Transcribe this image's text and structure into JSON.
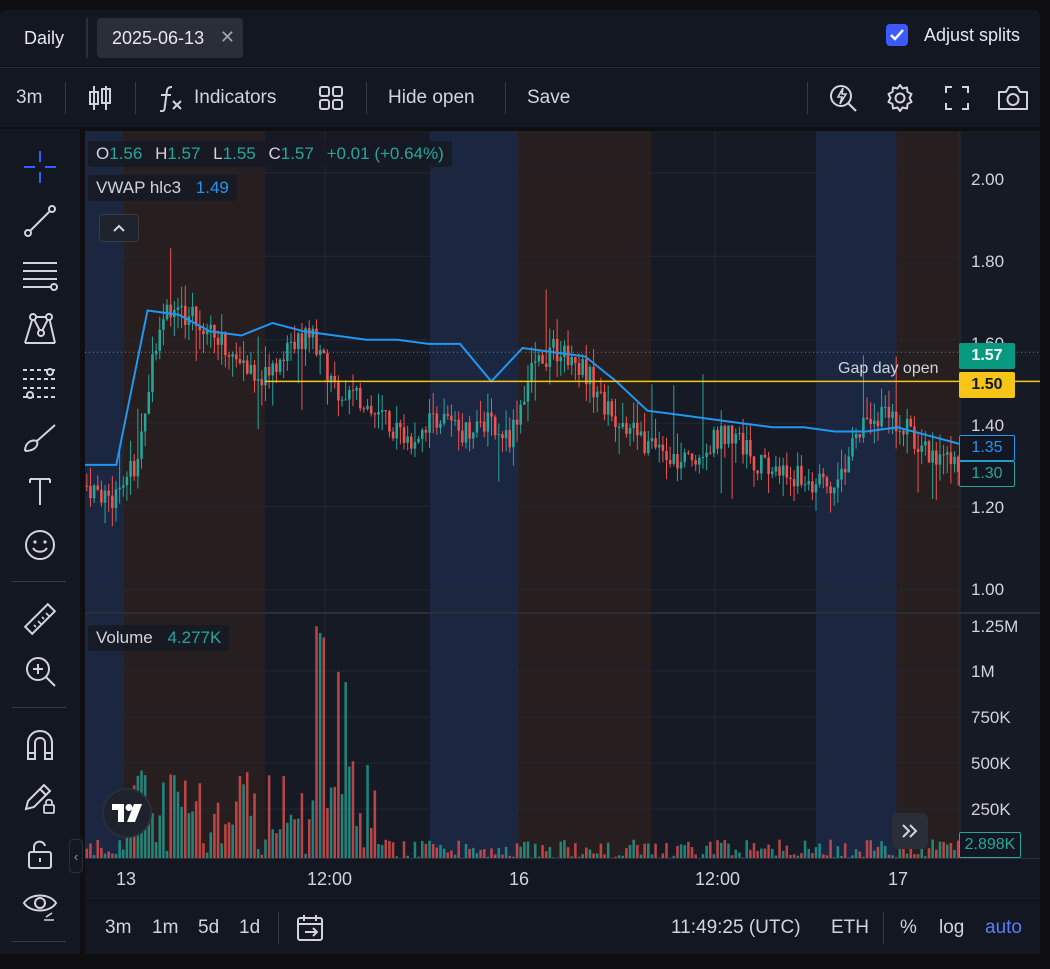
{
  "topbar": {
    "interval_tab": "Daily",
    "date_tab": "2025-06-13",
    "adjust_splits_label": "Adjust splits",
    "adjust_splits_checked": true
  },
  "toolbar": {
    "timeframe": "3m",
    "indicators_label": "Indicators",
    "hide_open_label": "Hide open",
    "save_label": "Save",
    "icons": [
      "candles-icon",
      "function-icon",
      "layout-grid-icon",
      "lightning-search-icon",
      "gear-icon",
      "fullscreen-icon",
      "camera-icon"
    ]
  },
  "left_tools": [
    "crosshair-icon",
    "trend-line-icon",
    "horizontal-lines-icon",
    "pattern-icon",
    "fib-lines-icon",
    "brush-icon",
    "text-icon",
    "emoji-icon",
    "ruler-icon",
    "zoom-in-icon",
    "magnet-icon",
    "pencil-lock-icon",
    "lock-icon",
    "eye-icon"
  ],
  "legend": {
    "o_label": "O",
    "o_value": "1.56",
    "h_label": "H",
    "h_value": "1.57",
    "l_label": "L",
    "l_value": "1.55",
    "c_label": "C",
    "c_value": "1.57",
    "change": "+0.01 (+0.64%)",
    "vwap_label": "VWAP hlc3",
    "vwap_value": "1.49",
    "volume_label": "Volume",
    "volume_value": "4.277K"
  },
  "price_axis": [
    "2.00",
    "1.80",
    "1.60",
    "1.40",
    "1.20",
    "1.00"
  ],
  "price_tags": {
    "last": "1.57",
    "gap_open": "1.50",
    "vwap": "1.35",
    "low": "1.30"
  },
  "gap_line_label": "Gap day open",
  "volume_axis": [
    "1.25M",
    "1M",
    "750K",
    "500K",
    "250K"
  ],
  "volume_tag": "2.898K",
  "time_axis": [
    "13",
    "12:00",
    "16",
    "12:00",
    "17"
  ],
  "bottombar": {
    "ranges": [
      "3m",
      "1m",
      "5d",
      "1d"
    ],
    "clock": "11:49:25 (UTC)",
    "session": "ETH",
    "percent": "%",
    "log": "log",
    "auto": "auto"
  },
  "colors": {
    "up": "#26a69a",
    "down": "#ef5350",
    "vwap": "#2196f3",
    "gap_line": "#f5c518",
    "accent": "#3d5afe"
  },
  "chart_data": {
    "type": "candlestick",
    "price_ylim": [
      0.95,
      2.1
    ],
    "sessions": [
      "13",
      "16",
      "17"
    ],
    "approx_price_path": [
      1.25,
      1.22,
      1.31,
      1.68,
      1.66,
      1.62,
      1.55,
      1.5,
      1.58,
      1.62,
      1.48,
      1.45,
      1.4,
      1.36,
      1.42,
      1.38,
      1.4,
      1.37,
      1.55,
      1.58,
      1.53,
      1.42,
      1.38,
      1.32,
      1.3,
      1.35,
      1.38,
      1.3,
      1.28,
      1.26,
      1.24,
      1.38,
      1.42,
      1.38,
      1.32,
      1.3
    ],
    "approx_vwap_path": [
      1.3,
      1.3,
      1.67,
      1.66,
      1.62,
      1.61,
      1.64,
      1.62,
      1.61,
      1.6,
      1.6,
      1.59,
      1.59,
      1.5,
      1.58,
      1.57,
      1.56,
      1.5,
      1.43,
      1.42,
      1.41,
      1.4,
      1.39,
      1.39,
      1.38,
      1.38,
      1.39,
      1.37,
      1.35
    ]
  }
}
